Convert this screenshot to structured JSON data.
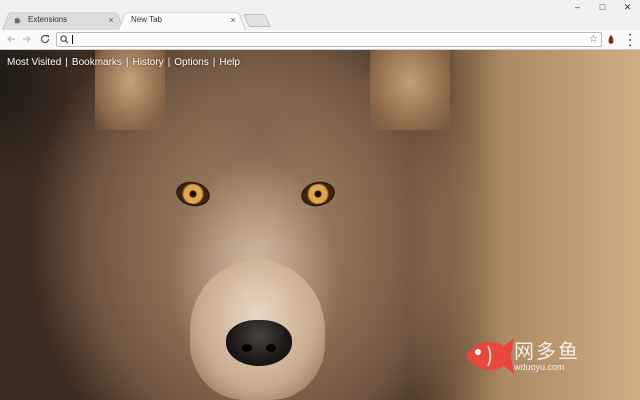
{
  "tabs": [
    {
      "title": "Extensions",
      "active": false
    },
    {
      "title": "New Tab",
      "active": true
    }
  ],
  "tab_close_glyph": "×",
  "window_controls": {
    "minimize": "–",
    "maximize": "□",
    "close": "✕"
  },
  "omnibox": {
    "value": "",
    "placeholder": ""
  },
  "bookmark_star": "☆",
  "icons": [
    "puzzle-icon",
    "back-icon",
    "forward-icon",
    "reload-icon",
    "search-icon",
    "star-icon",
    "extension-icon",
    "menu-icon",
    "fish-logo-icon"
  ],
  "top_links": [
    {
      "label": "Most Visited"
    },
    {
      "label": "Bookmarks"
    },
    {
      "label": "History"
    },
    {
      "label": "Options"
    },
    {
      "label": "Help"
    }
  ],
  "link_separator": "|",
  "watermark": {
    "name": "网多鱼",
    "url": "wduoyu.com",
    "color": "#e8483c"
  },
  "colors": {
    "tabstrip": "#f1f1f1",
    "toolbar": "#fbfbfb",
    "link_text": "#ffffff"
  }
}
